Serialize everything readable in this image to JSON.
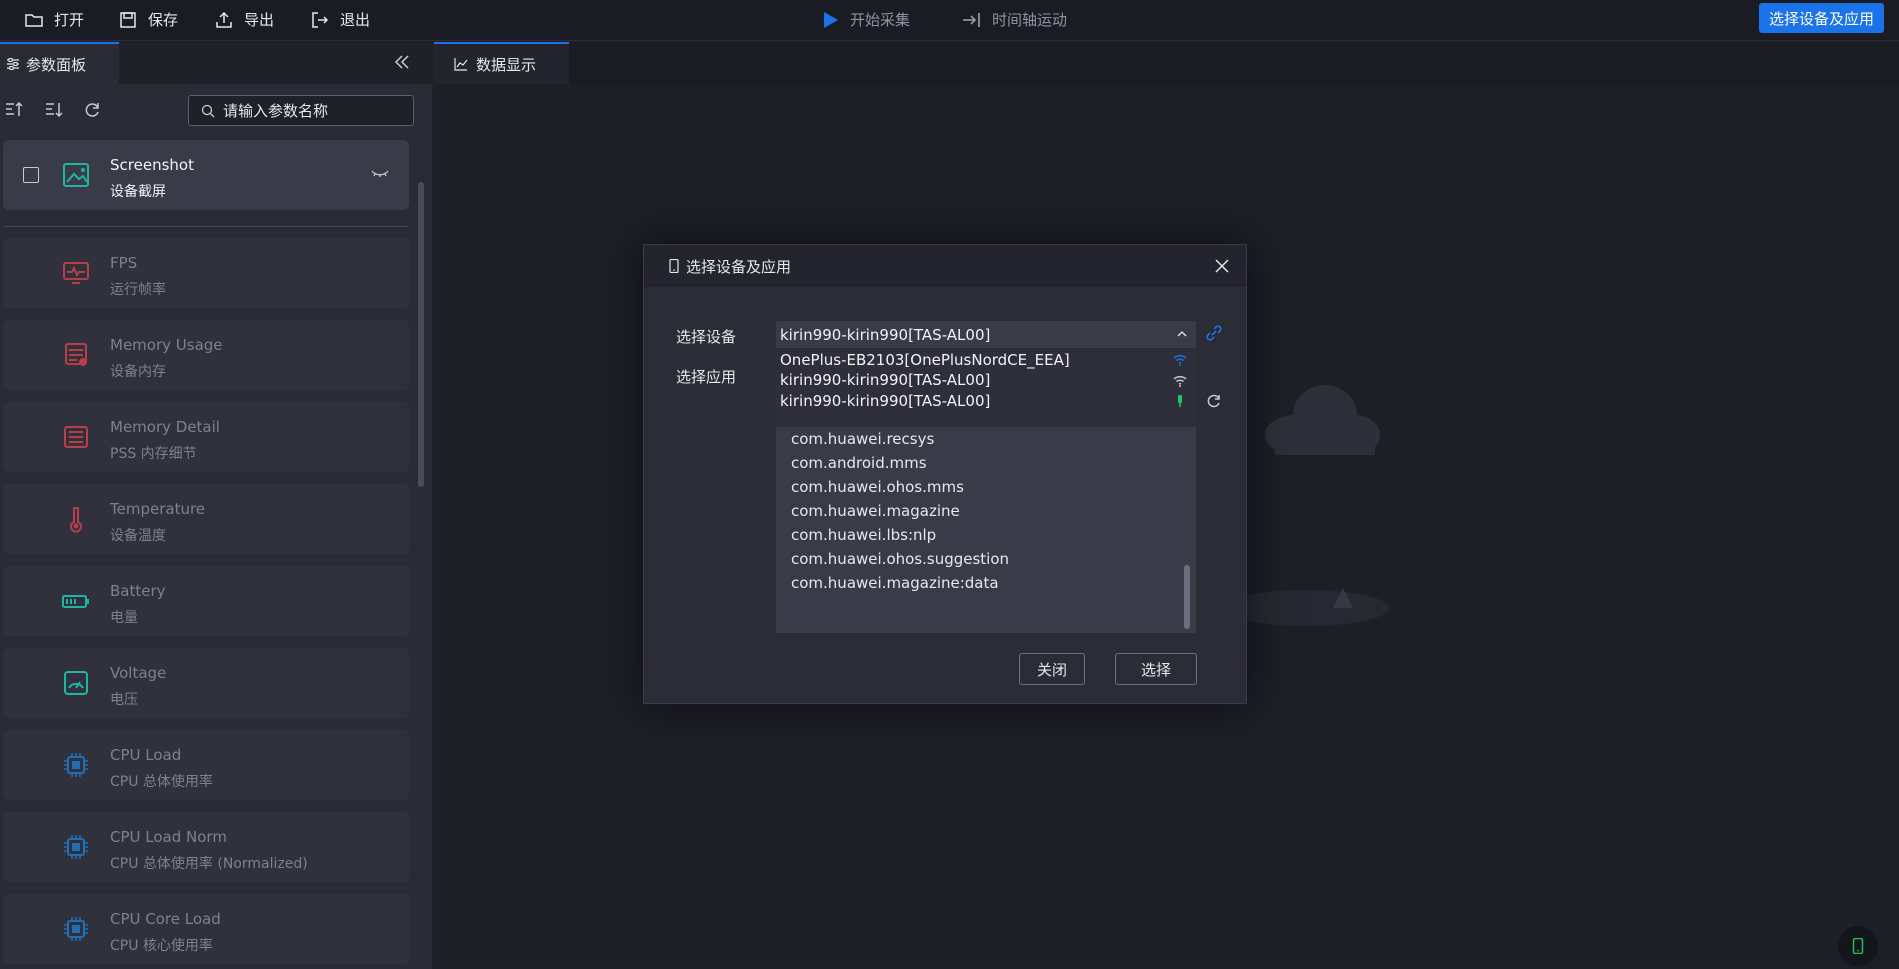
{
  "toolbar": {
    "open_label": "打开",
    "save_label": "保存",
    "export_label": "导出",
    "exit_label": "退出",
    "start_capture_label": "开始采集",
    "timeline_label": "时间轴运动",
    "select_device_app_label": "选择设备及应用",
    "accent_color": "#1a73e8"
  },
  "left_panel": {
    "tab_label": "参数面板",
    "search_placeholder": "请输入参数名称",
    "items": [
      {
        "name": "Screenshot",
        "sub": "设备截屏",
        "icon": "screenshot-icon",
        "color": "#1fb5a3"
      },
      {
        "name": "FPS",
        "sub": "运行帧率",
        "icon": "fps-monitor-icon",
        "color": "#b83e4a"
      },
      {
        "name": "Memory Usage",
        "sub": "设备内存",
        "icon": "memory-usage-icon",
        "color": "#b83e4a"
      },
      {
        "name": "Memory Detail",
        "sub": "PSS 内存细节",
        "icon": "memory-detail-icon",
        "color": "#b83e4a"
      },
      {
        "name": "Temperature",
        "sub": "设备温度",
        "icon": "thermometer-icon",
        "color": "#b83e4a"
      },
      {
        "name": "Battery",
        "sub": "电量",
        "icon": "battery-icon",
        "color": "#1fb5a3"
      },
      {
        "name": "Voltage",
        "sub": "电压",
        "icon": "voltage-icon",
        "color": "#1fb5a3"
      },
      {
        "name": "CPU Load",
        "sub": "CPU 总体使用率",
        "icon": "cpu-icon",
        "color": "#1f6fb5"
      },
      {
        "name": "CPU Load Norm",
        "sub": "CPU 总体使用率 (Normalized)",
        "icon": "cpu-icon",
        "color": "#1f6fb5"
      },
      {
        "name": "CPU Core Load",
        "sub": "CPU 核心使用率",
        "icon": "cpu-icon",
        "color": "#1f6fb5"
      }
    ]
  },
  "main": {
    "tab_label": "数据显示"
  },
  "modal": {
    "title": "选择设备及应用",
    "device_label": "选择设备",
    "app_label": "选择应用",
    "selected_device": "kirin990-kirin990[TAS-AL00]",
    "device_options": [
      {
        "label": "OnePlus-EB2103[OnePlusNordCE_EEA]",
        "connection": "wifi-icon",
        "color": "#1a73e8"
      },
      {
        "label": "kirin990-kirin990[TAS-AL00]",
        "connection": "wifi-icon",
        "color": "#c8cbd6"
      },
      {
        "label": "kirin990-kirin990[TAS-AL00]",
        "connection": "usb-icon",
        "color": "#22c55e"
      }
    ],
    "apps": [
      "com.huawei.recsys",
      "com.android.mms",
      "com.huawei.ohos.mms",
      "com.huawei.magazine",
      "com.huawei.lbs:nlp",
      "com.huawei.ohos.suggestion",
      "com.huawei.magazine:data"
    ],
    "close_label": "关闭",
    "select_label": "选择"
  }
}
